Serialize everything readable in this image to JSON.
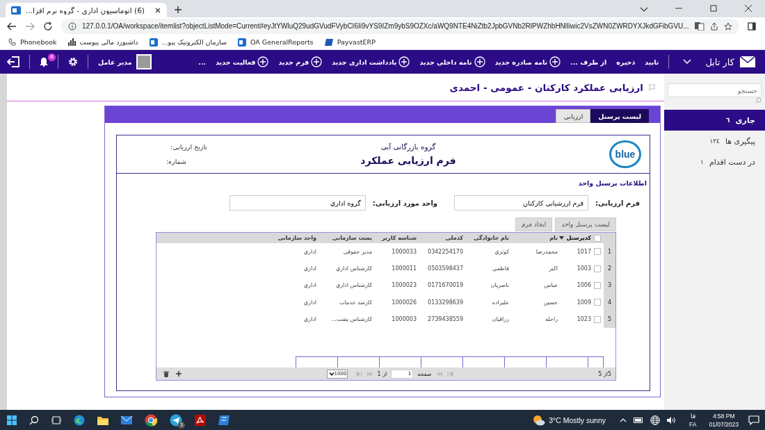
{
  "browser": {
    "tab": {
      "title": "(6) اتوماسیون اداری - گروه نرم افزا..."
    },
    "url": "127.0.0.1/OA/workspace/itemlist?objectListMode=Current#eyJtYWluQ29udGVudFVybCI6Ii9vYS9IZm9ybS9OZXc/aWQ9NTE4NiZtb2JpbGVNb2RlPWZhbHNlIiwic2VsZWN0ZWRDYXJkdGFibGVU...",
    "bookmarks": [
      {
        "label": "PayvastERP",
        "kind": "erp"
      },
      {
        "label": "OA GeneralReports",
        "kind": "app"
      },
      {
        "label": "سازمان الکترونیک پیو...",
        "kind": "app"
      },
      {
        "label": "داشبورد مالی پیوست",
        "kind": "chart"
      },
      {
        "label": "Phonebook",
        "kind": "phone"
      }
    ]
  },
  "nav": {
    "brand": "کار تابل",
    "actions": [
      {
        "label": "تایید",
        "kind": "plain"
      },
      {
        "label": "ذخیره",
        "kind": "plain"
      },
      {
        "label": "از طرف ...",
        "kind": "plain"
      },
      {
        "label": "نامه صادره جدید",
        "kind": "plus"
      },
      {
        "label": "نامه داخلی جدید",
        "kind": "plus"
      },
      {
        "label": "یادداشت اداری جدید",
        "kind": "plus"
      },
      {
        "label": "فرم جدید",
        "kind": "plus"
      },
      {
        "label": "فعالیت جدید",
        "kind": "plus"
      },
      {
        "label": "...",
        "kind": "plain"
      }
    ],
    "user": "مدیر عامل",
    "notifications": "6"
  },
  "sidebar": {
    "search_placeholder": "جستجو",
    "items": [
      {
        "label": "جاری",
        "count": "٦",
        "selected": true
      },
      {
        "label": "پیگیری ها",
        "count": "١٣٤",
        "selected": false
      },
      {
        "label": "در دست اقدام",
        "count": "١",
        "selected": false
      }
    ]
  },
  "page_title": "ارزیابی عملکرد کارکنان - عمومی - احمدی",
  "form": {
    "tabs": [
      {
        "label": "لیست پرسنل",
        "selected": true
      },
      {
        "label": "ارزیابی",
        "selected": false
      }
    ],
    "header": {
      "logo_text": "blue",
      "company": "گروه بازرگانی آبی",
      "title": "فرم ارزیابی عملکرد",
      "date_label": "تاریخ ارزیابی:",
      "number_label": "شماره:"
    },
    "section_title": "اطلاعات پرسنل واحد",
    "fields": [
      {
        "label": "فرم ارزیابی:",
        "value": "فرم ارزشیابی کارکنان"
      },
      {
        "label": "واحد مورد ارزیابی:",
        "value": "گروه اداري"
      }
    ],
    "buttons": [
      {
        "label": "لیست پرسنل واحد"
      },
      {
        "label": "ایجاد فرم"
      }
    ],
    "grid": {
      "all_checked": false,
      "columns": [
        {
          "label": "کدپرسنل",
          "sorted": true
        },
        {
          "label": "نام",
          "sorted": false
        },
        {
          "label": "نام خانوادگی",
          "sorted": false
        },
        {
          "label": "کدملی",
          "sorted": false
        },
        {
          "label": "شناسه کاربر",
          "sorted": false
        },
        {
          "label": "پست سازمانی",
          "sorted": false
        },
        {
          "label": "واحد سازمانی",
          "sorted": false
        }
      ],
      "rows": [
        {
          "index": "1",
          "checked": false,
          "cells": [
            "1017",
            "محمدرضا",
            "کوثري",
            "0342254170",
            "1000033",
            "مدیر حقوقی",
            "اداري"
          ]
        },
        {
          "index": "2",
          "checked": false,
          "cells": [
            "1003",
            "اکبر",
            "فاطمي",
            "0503598437",
            "1000011",
            "کارشناس اداري",
            "اداري"
          ]
        },
        {
          "index": "3",
          "checked": false,
          "cells": [
            "1006",
            "عباس",
            "ناصريان",
            "0171670019",
            "1000023",
            "کارشناس اداري",
            "اداري"
          ]
        },
        {
          "index": "4",
          "checked": false,
          "cells": [
            "1009",
            "حسین",
            "علیزاده",
            "0133298639",
            "1000026",
            "کارمند خدمات",
            "اداري"
          ]
        },
        {
          "index": "5",
          "checked": false,
          "cells": [
            "1023",
            "راحله",
            "رزاقيان",
            "2739438559",
            "1000003",
            "کارشناس پشت...",
            "اداري"
          ]
        }
      ],
      "footer": {
        "count": "5از 5",
        "page_label": "صفحه",
        "page_value": "1",
        "of_label": "از 1",
        "page_size": "1000"
      }
    }
  },
  "taskbar": {
    "telegram_badge": "3",
    "weather": "3°C  Mostly sunny",
    "lang_short": "فا",
    "lang_code": "FA",
    "time": "4:58 PM",
    "date": "01/07/2023"
  }
}
